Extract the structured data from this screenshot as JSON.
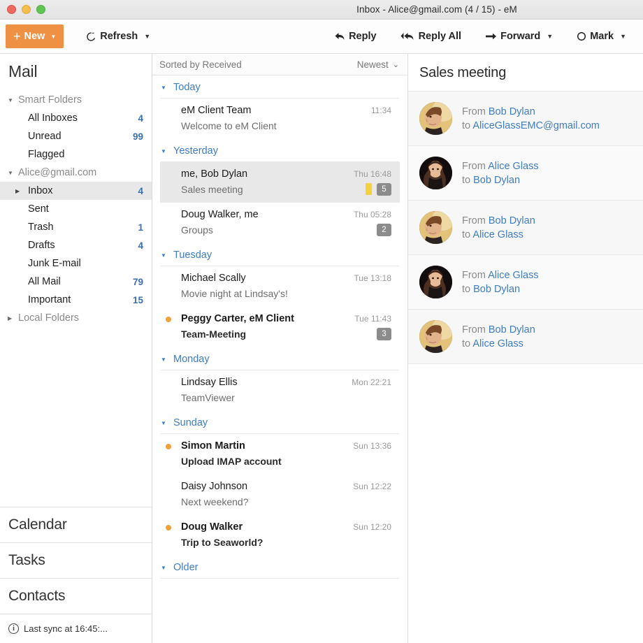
{
  "window": {
    "title": "Inbox - Alice@gmail.com (4 / 15) - eM",
    "controls": {
      "close": "close-button",
      "minimize": "minimize-button",
      "maximize": "maximize-button"
    }
  },
  "toolbar": {
    "new_label": "New",
    "refresh_label": "Refresh",
    "reply_label": "Reply",
    "reply_all_label": "Reply All",
    "forward_label": "Forward",
    "mark_label": "Mark",
    "accent_color": "#ef9144"
  },
  "sidebar": {
    "title": "Mail",
    "groups": [
      {
        "label": "Smart Folders",
        "expanded": true,
        "items": [
          {
            "label": "All Inboxes",
            "count": "4"
          },
          {
            "label": "Unread",
            "count": "99"
          },
          {
            "label": "Flagged",
            "count": ""
          }
        ]
      },
      {
        "label": "Alice@gmail.com",
        "expanded": true,
        "items": [
          {
            "label": "Inbox",
            "count": "4",
            "selected": true,
            "expandable": true
          },
          {
            "label": "Sent",
            "count": ""
          },
          {
            "label": "Trash",
            "count": "1"
          },
          {
            "label": "Drafts",
            "count": "4"
          },
          {
            "label": "Junk E-mail",
            "count": ""
          },
          {
            "label": "All Mail",
            "count": "79"
          },
          {
            "label": "Important",
            "count": "15"
          }
        ]
      },
      {
        "label": "Local Folders",
        "expanded": false,
        "items": []
      }
    ],
    "sections": [
      "Calendar",
      "Tasks",
      "Contacts"
    ],
    "status": "Last sync at 16:45:..."
  },
  "list": {
    "sort_label": "Sorted by Received",
    "order_label": "Newest",
    "groups": [
      {
        "label": "Today",
        "messages": [
          {
            "from": "eM Client Team",
            "subject": "Welcome to eM Client",
            "time": "11:34",
            "unread": false,
            "count": "",
            "flag": false
          }
        ]
      },
      {
        "label": "Yesterday",
        "messages": [
          {
            "from": "me, Bob Dylan",
            "subject": "Sales meeting",
            "time": "Thu 16:48",
            "unread": false,
            "count": "5",
            "flag": true,
            "selected": true
          },
          {
            "from": "Doug Walker, me",
            "subject": "Groups",
            "time": "Thu 05:28",
            "unread": false,
            "count": "2",
            "flag": false
          }
        ]
      },
      {
        "label": "Tuesday",
        "messages": [
          {
            "from": "Michael Scally",
            "subject": "Movie night at Lindsay's!",
            "time": "Tue 13:18",
            "unread": false,
            "count": "",
            "flag": false
          },
          {
            "from": "Peggy Carter, eM Client",
            "subject": "Team-Meeting",
            "time": "Tue 11:43",
            "unread": true,
            "count": "3",
            "flag": false
          }
        ]
      },
      {
        "label": "Monday",
        "messages": [
          {
            "from": "Lindsay Ellis",
            "subject": "TeamViewer",
            "time": "Mon 22:21",
            "unread": false,
            "count": "",
            "flag": false
          }
        ]
      },
      {
        "label": "Sunday",
        "messages": [
          {
            "from": "Simon Martin",
            "subject": "Upload IMAP account",
            "time": "Sun 13:36",
            "unread": true,
            "count": "",
            "flag": false
          },
          {
            "from": "Daisy Johnson",
            "subject": "Next weekend?",
            "time": "Sun 12:22",
            "unread": false,
            "count": "",
            "flag": false
          },
          {
            "from": "Doug Walker",
            "subject": "Trip to Seaworld?",
            "time": "Sun 12:20",
            "unread": true,
            "count": "",
            "flag": false
          }
        ]
      },
      {
        "label": "Older",
        "messages": []
      }
    ]
  },
  "conversation": {
    "title": "Sales meeting",
    "from_label": "From",
    "to_label": "to",
    "messages": [
      {
        "from": "Bob Dylan",
        "to": "AliceGlassEMC@gmail.com",
        "avatar": "male"
      },
      {
        "from": "Alice Glass",
        "to": "Bob Dylan",
        "avatar": "female"
      },
      {
        "from": "Bob Dylan",
        "to": "Alice Glass",
        "avatar": "male"
      },
      {
        "from": "Alice Glass",
        "to": "Bob Dylan",
        "avatar": "female"
      },
      {
        "from": "Bob Dylan",
        "to": "Alice Glass",
        "avatar": "male"
      }
    ]
  }
}
